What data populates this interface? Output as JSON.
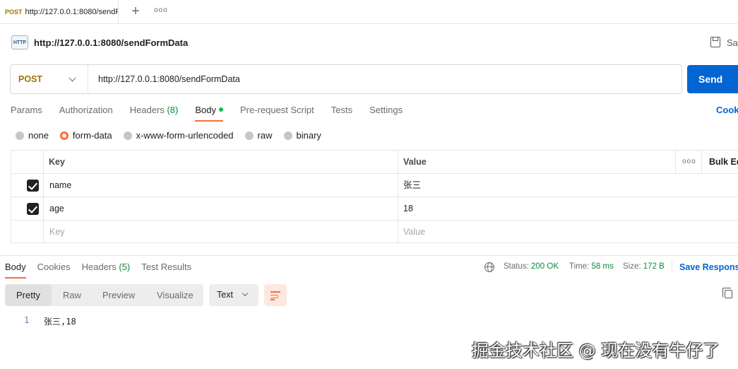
{
  "tabstrip": {
    "tab_method": "POST",
    "tab_url": "http://127.0.0.1:8080/sendFormData",
    "add_label": "+",
    "more_label": "ooo"
  },
  "header": {
    "icon_text": "HTTP",
    "title": "http://127.0.0.1:8080/sendFormData",
    "save_label": "Sav"
  },
  "request": {
    "method": "POST",
    "url": "http://127.0.0.1:8080/sendFormData",
    "send_label": "Send"
  },
  "request_tabs": {
    "params": "Params",
    "authorization": "Authorization",
    "headers": "Headers",
    "headers_count": "(8)",
    "body": "Body",
    "prerequest": "Pre-request Script",
    "tests": "Tests",
    "settings": "Settings",
    "cookies": "Cook"
  },
  "body_types": {
    "none": "none",
    "form_data": "form-data",
    "urlencoded": "x-www-form-urlencoded",
    "raw": "raw",
    "binary": "binary",
    "selected": "form-data"
  },
  "form_table": {
    "key_header": "Key",
    "value_header": "Value",
    "more": "ooo",
    "bulk_edit": "Bulk Ed",
    "rows": [
      {
        "key": "name",
        "value": "张三",
        "checked": true
      },
      {
        "key": "age",
        "value": "18",
        "checked": true
      }
    ],
    "key_placeholder": "Key",
    "value_placeholder": "Value"
  },
  "response": {
    "tabs": {
      "body": "Body",
      "cookies": "Cookies",
      "headers": "Headers",
      "headers_count": "(5)",
      "test_results": "Test Results"
    },
    "status_label": "Status:",
    "status_value": "200 OK",
    "time_label": "Time:",
    "time_value": "58 ms",
    "size_label": "Size:",
    "size_value": "172 B",
    "save_label": "Save Respons",
    "views": {
      "pretty": "Pretty",
      "raw": "Raw",
      "preview": "Preview",
      "visualize": "Visualize"
    },
    "format": "Text",
    "lines": [
      {
        "num": "1",
        "content": "张三,18"
      }
    ]
  },
  "watermark": "掘金技术社区 @ 现在没有牛仔了",
  "colors": {
    "accent": "#ff6c37",
    "send_button": "#0265d2",
    "method": "#a07300",
    "status_ok": "#0c8a3c"
  }
}
